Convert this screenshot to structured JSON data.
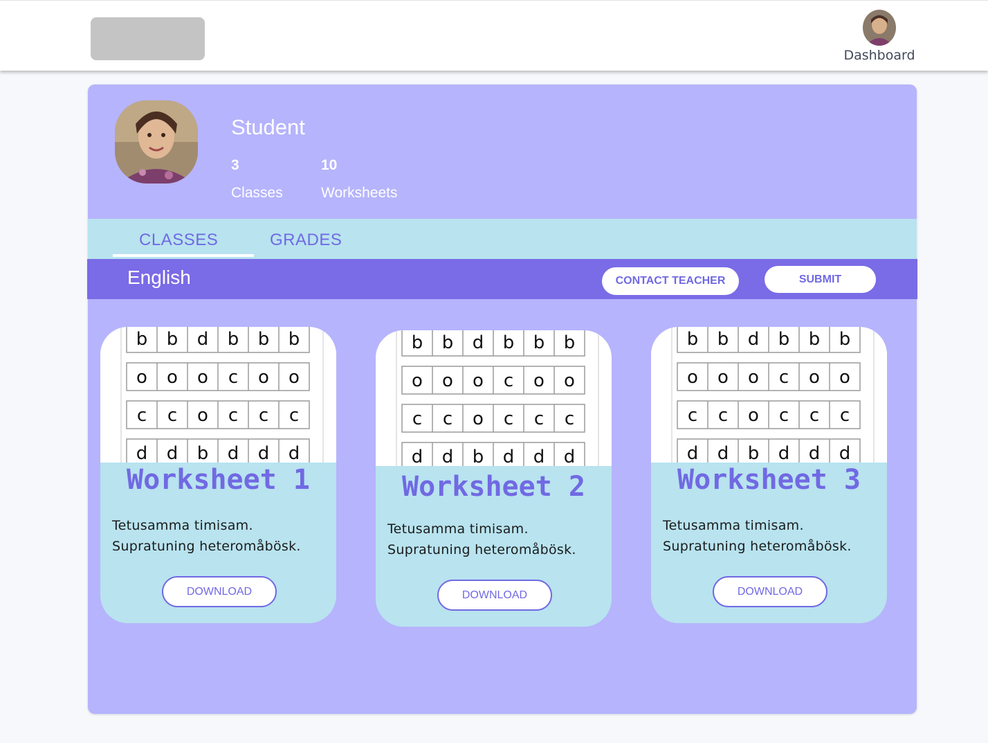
{
  "header": {
    "nav_label": "Dashboard"
  },
  "profile": {
    "name": "Student",
    "stats": [
      {
        "value": "3",
        "label": "Classes"
      },
      {
        "value": "10",
        "label": "Worksheets"
      }
    ]
  },
  "tabs": [
    {
      "label": "CLASSES",
      "active": true
    },
    {
      "label": "GRADES",
      "active": false
    }
  ],
  "class_bar": {
    "name": "English",
    "contact_label": "CONTACT TEACHER",
    "submit_label": "SUBMIT"
  },
  "worksheet_letters": [
    [
      "b",
      "b",
      "d",
      "b",
      "b",
      "b"
    ],
    [
      "o",
      "o",
      "o",
      "c",
      "o",
      "o"
    ],
    [
      "c",
      "c",
      "o",
      "c",
      "c",
      "c"
    ],
    [
      "d",
      "d",
      "b",
      "d",
      "d",
      "d"
    ]
  ],
  "worksheets": [
    {
      "title": "Worksheet 1",
      "desc_line1": "Tetusamma timisam.",
      "desc_line2": "Supratuning heteromåbösk.",
      "download_label": "DOWNLOAD"
    },
    {
      "title": "Worksheet 2",
      "desc_line1": "Tetusamma timisam.",
      "desc_line2": "Supratuning heteromåbösk.",
      "download_label": "DOWNLOAD"
    },
    {
      "title": "Worksheet 3",
      "desc_line1": "Tetusamma timisam.",
      "desc_line2": "Supratuning heteromåbösk.",
      "download_label": "DOWNLOAD"
    }
  ],
  "colors": {
    "panel": "#b6b4fc",
    "accent": "#7169e3",
    "class_bar": "#7a6be6",
    "tab_bar": "#b8e3ef"
  }
}
